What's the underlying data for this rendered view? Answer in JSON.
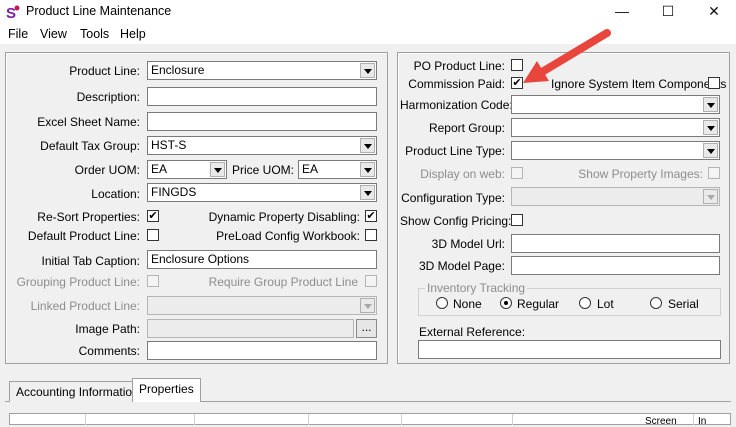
{
  "window": {
    "title": "Product Line Maintenance"
  },
  "menu": {
    "items": [
      "File",
      "View",
      "Tools",
      "Help"
    ]
  },
  "left": {
    "product_line_label": "Product Line:",
    "product_line_value": "Enclosure",
    "description_label": "Description:",
    "description_value": "",
    "excel_sheet_label": "Excel Sheet Name:",
    "excel_sheet_value": "",
    "default_tax_label": "Default Tax Group:",
    "default_tax_value": "HST-S",
    "order_uom_label": "Order UOM:",
    "order_uom_value": "EA",
    "price_uom_label": "Price UOM:",
    "price_uom_value": "EA",
    "location_label": "Location:",
    "location_value": "FINGDS",
    "resort_label": "Re-Sort Properties:",
    "resort_checked": "✔",
    "dynamic_label": "Dynamic Property Disabling:",
    "dynamic_checked": "✔",
    "default_pl_label": "Default Product Line:",
    "default_pl_checked": "",
    "preload_label": "PreLoad Config Workbook:",
    "preload_checked": "",
    "initial_tab_label": "Initial Tab Caption:",
    "initial_tab_value": "Enclosure Options",
    "grouping_label": "Grouping Product Line:",
    "require_group_label": "Require Group Product Line",
    "linked_label": "Linked Product Line:",
    "linked_value": "",
    "image_path_label": "Image Path:",
    "image_path_value": "",
    "image_browse_label": "...",
    "comments_label": "Comments:",
    "comments_value": ""
  },
  "right": {
    "po_label": "PO Product Line:",
    "po_checked": "",
    "commission_label": "Commission Paid:",
    "commission_checked": "✔",
    "ignore_label": "Ignore System Item Components",
    "ignore_checked": "",
    "harmonization_label": "Harmonization Code:",
    "harmonization_value": "",
    "report_group_label": "Report Group:",
    "report_group_value": "",
    "pl_type_label": "Product Line Type:",
    "pl_type_value": "",
    "display_web_label": "Display on web:",
    "show_images_label": "Show Property Images:",
    "config_type_label": "Configuration Type:",
    "config_type_value": "",
    "show_config_label": "Show Config Pricing:",
    "show_config_checked": "",
    "model_url_label": "3D Model Url:",
    "model_url_value": "",
    "model_page_label": "3D Model Page:",
    "model_page_value": "",
    "inventory_title": "Inventory Tracking",
    "inventory_options": [
      "None",
      "Regular",
      "Lot",
      "Serial"
    ],
    "inventory_selected": "Regular",
    "external_ref_label": "External Reference:",
    "external_ref_value": ""
  },
  "tabs": [
    "Accounting Information",
    "Properties"
  ],
  "grid": {
    "headers": [
      "",
      "",
      "",
      "",
      "",
      "Screen",
      "In"
    ]
  },
  "colors": {
    "arrow": "#e8453c"
  }
}
